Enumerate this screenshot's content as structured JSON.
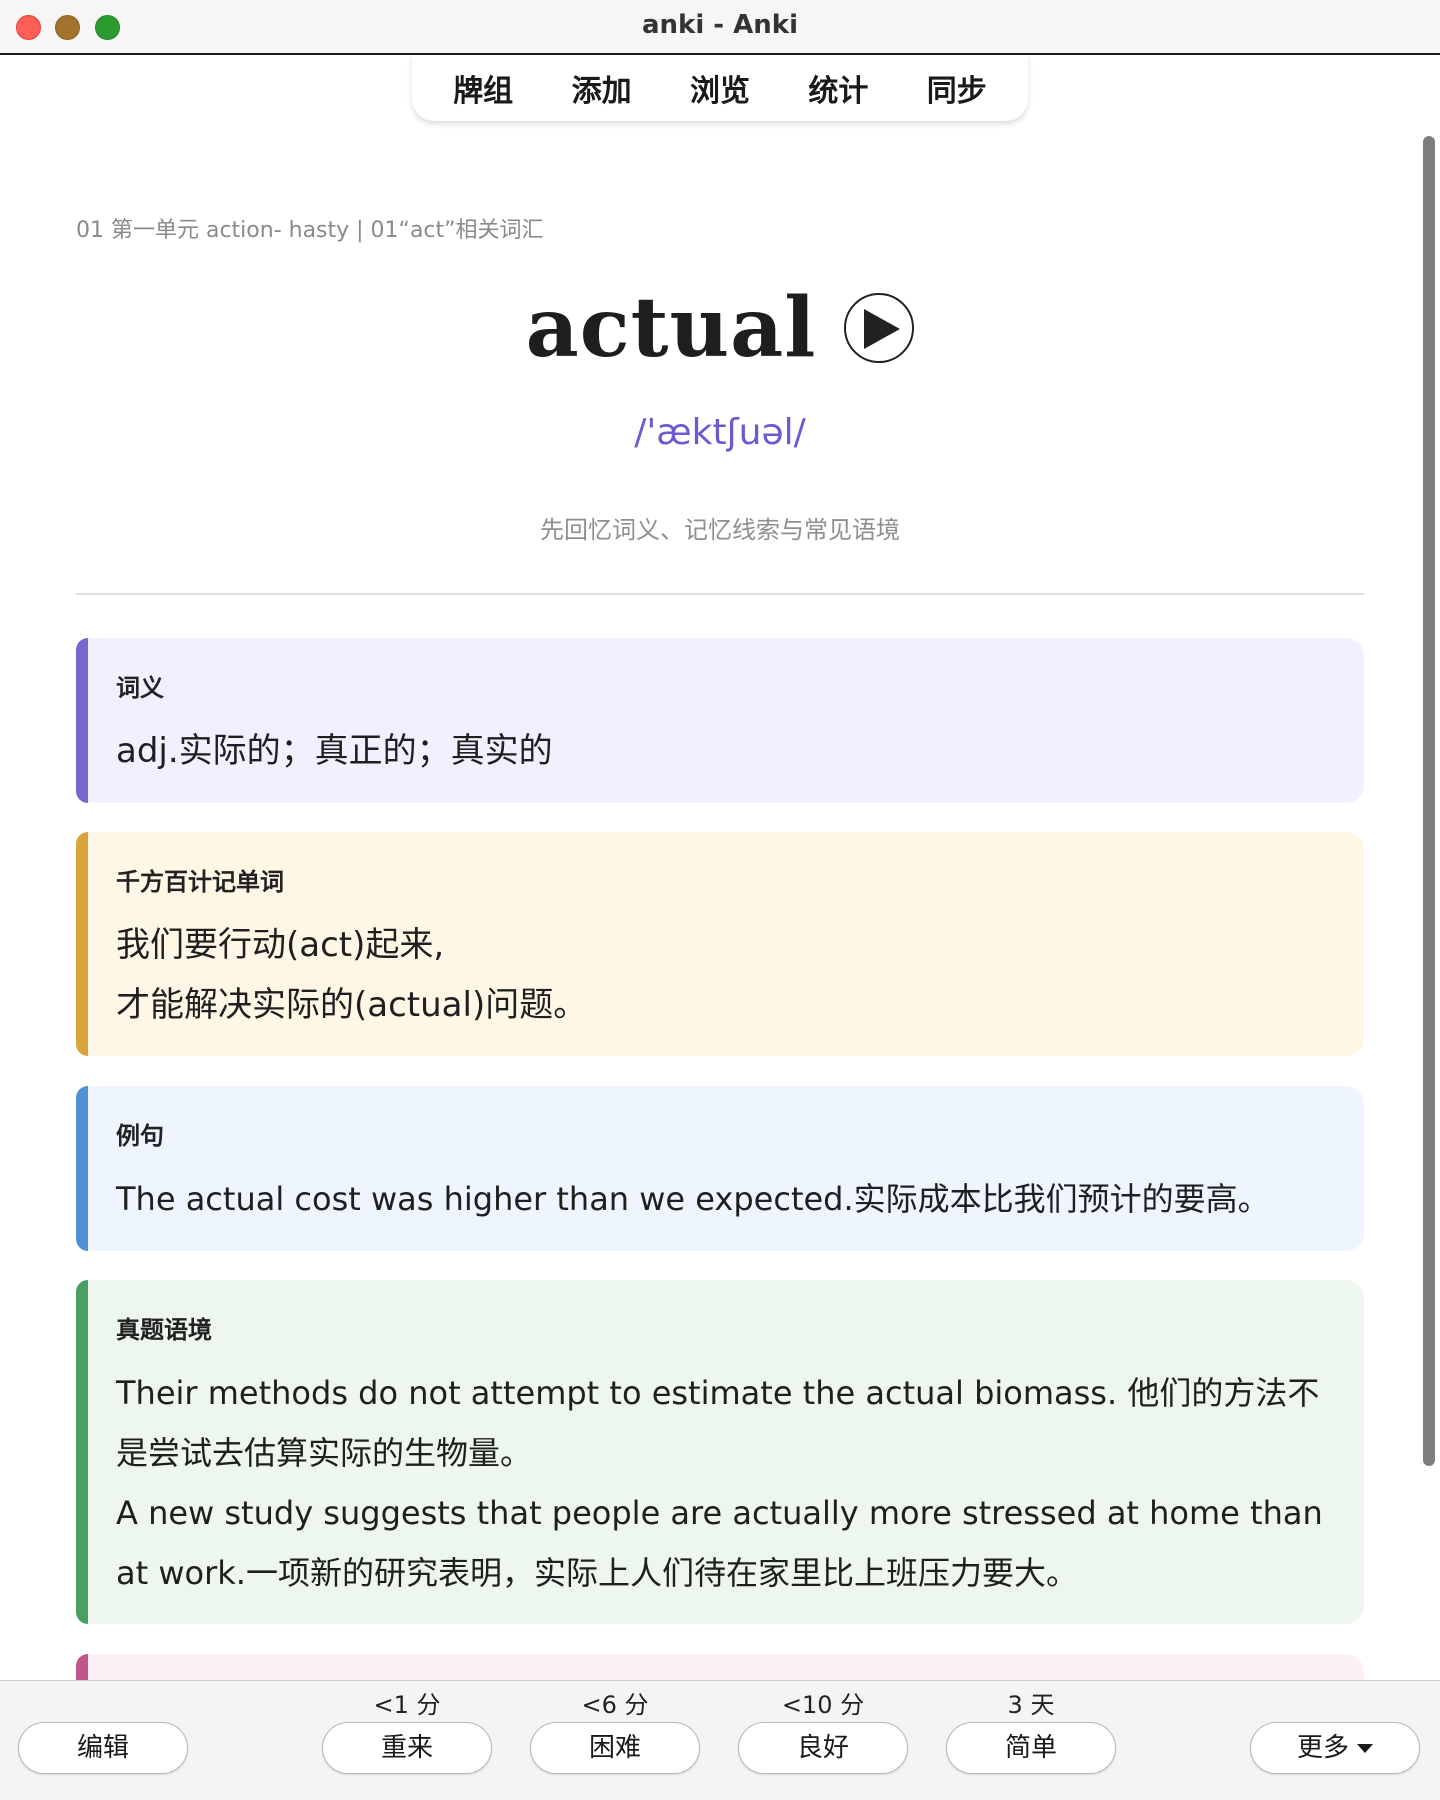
{
  "window": {
    "title": "anki - Anki"
  },
  "nav": [
    "牌组",
    "添加",
    "浏览",
    "统计",
    "同步"
  ],
  "card": {
    "breadcrumb": "01 第一单元 action- hasty | 01“act”相关词汇",
    "word": "actual",
    "phonetic": "/'æktʃuəl/",
    "hint": "先回忆词义、记忆线索与常见语境",
    "sections": [
      {
        "title": "词义",
        "body": "adj.实际的；真正的；真实的",
        "accent": "#7a66cc"
      },
      {
        "title": "千方百计记单词",
        "body": "我们要行动(act)起来,\n才能解决实际的(actual)问题。",
        "accent": "#dba43a"
      },
      {
        "title": "例句",
        "body": "The actual cost was higher than we expected.实际成本比我们预计的要高。",
        "accent": "#4f91d2"
      },
      {
        "title": "真题语境",
        "body": "Their methods do not attempt to estimate the actual biomass. 他们的方法不是尝试去估算实际的生物量。\nA new study suggests that people are actually more stressed at home than at work.一项新的研究表明，实际上人们待在家里比上班压力要大。",
        "accent": "#4aa060"
      }
    ]
  },
  "bottom": {
    "edit_label": "编辑",
    "more_label": "更多",
    "answers": [
      {
        "due": "<1 分",
        "label": "重来"
      },
      {
        "due": "<6 分",
        "label": "困难"
      },
      {
        "due": "<10 分",
        "label": "良好"
      },
      {
        "due": "3 天",
        "label": "简单"
      }
    ]
  }
}
